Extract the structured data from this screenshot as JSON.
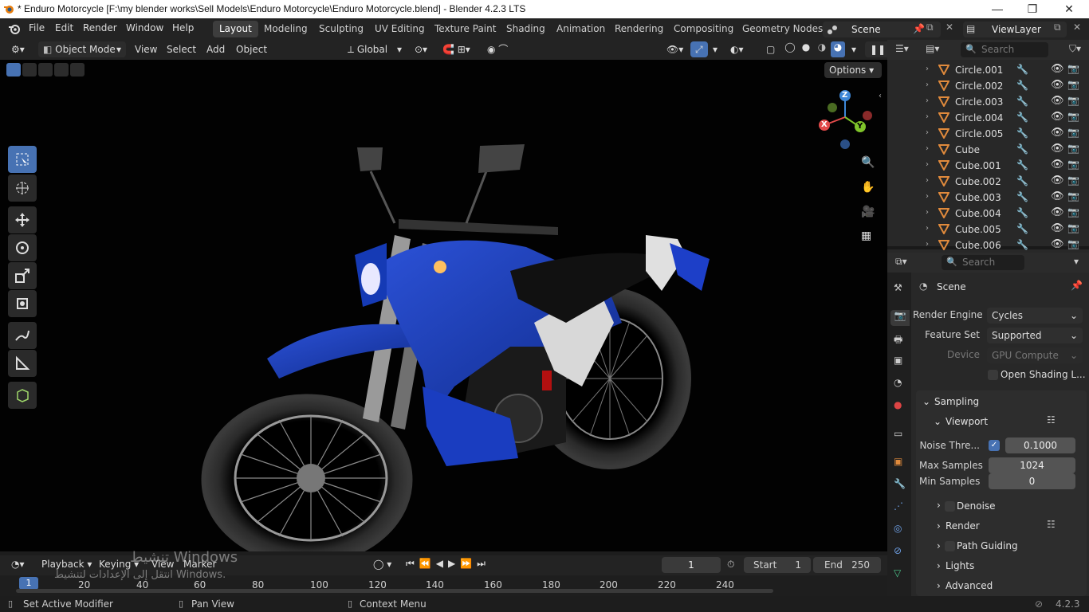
{
  "titlebar": {
    "title": "* Enduro Motorcycle [F:\\my blender works\\Sell Models\\Enduro Motorcycle\\Enduro Motorcycle.blend] - Blender 4.2.3 LTS",
    "minimize": "—",
    "maximize": "❐",
    "close": "✕"
  },
  "menu": {
    "file": "File",
    "edit": "Edit",
    "render": "Render",
    "window": "Window",
    "help": "Help"
  },
  "workspaces": [
    "Layout",
    "Modeling",
    "Sculpting",
    "UV Editing",
    "Texture Paint",
    "Shading",
    "Animation",
    "Rendering",
    "Compositing",
    "Geometry Nodes"
  ],
  "scene_name": "Scene",
  "view_layer": "ViewLayer",
  "header": {
    "mode": "Object Mode",
    "view": "View",
    "select": "Select",
    "add": "Add",
    "object": "Object",
    "transform": "Global",
    "options": "Options"
  },
  "outliner": {
    "search_placeholder": "Search",
    "items": [
      "Circle.001",
      "Circle.002",
      "Circle.003",
      "Circle.004",
      "Circle.005",
      "Cube",
      "Cube.001",
      "Cube.002",
      "Cube.003",
      "Cube.004",
      "Cube.005",
      "Cube.006"
    ]
  },
  "properties": {
    "search_placeholder": "Search",
    "context": "Scene",
    "render_engine_label": "Render Engine",
    "render_engine": "Cycles",
    "feature_set_label": "Feature Set",
    "feature_set": "Supported",
    "device_label": "Device",
    "device": "GPU Compute",
    "open_shading": "Open Shading L...",
    "sampling": "Sampling",
    "viewport": "Viewport",
    "noise_threshold_label": "Noise Thre...",
    "noise_threshold": "0.1000",
    "max_samples_label": "Max Samples",
    "max_samples": "1024",
    "min_samples_label": "Min Samples",
    "min_samples": "0",
    "denoise": "Denoise",
    "render": "Render",
    "path_guiding": "Path Guiding",
    "lights": "Lights",
    "advanced": "Advanced"
  },
  "timeline": {
    "playback": "Playback",
    "keying": "Keying",
    "view": "View",
    "marker": "Marker",
    "current_frame": "1",
    "start_label": "Start",
    "start": "1",
    "end_label": "End",
    "end": "250",
    "frame_indicator": "1",
    "ticks": [
      "20",
      "40",
      "60",
      "80",
      "100",
      "120",
      "140",
      "160",
      "180",
      "200",
      "220",
      "240"
    ]
  },
  "watermark": {
    "line1": "تنشيط Windows",
    "line2": "انتقل إلى الإعدادات لتنشيط Windows."
  },
  "status": {
    "set_active_modifier": "Set Active Modifier",
    "pan_view": "Pan View",
    "context_menu": "Context Menu",
    "version": "4.2.3"
  },
  "gizmo": {
    "x": "X",
    "y": "Y",
    "z": "Z"
  },
  "colors": {
    "accent": "#4772b3",
    "bike_blue": "#1b3fb8",
    "axis_x": "#e24a4a",
    "axis_y": "#7fc42a",
    "axis_z": "#3d87d8",
    "mesh_icon": "#e08a3c"
  }
}
